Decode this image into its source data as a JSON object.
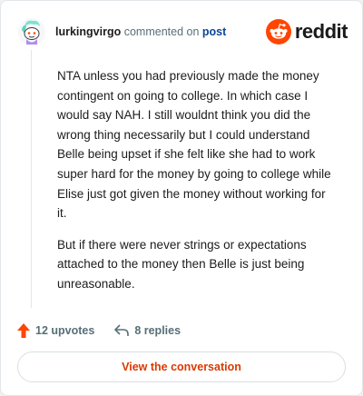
{
  "comment": {
    "author": "lurkingvirgo",
    "action_text": "commented on",
    "post_link": "post",
    "paragraphs": [
      "NTA unless you had previously made the money contingent on going to college. In which case I would say NAH. I still wouldnt think you did the wrong thing necessarily but I could understand Belle being upset if she felt like she had to work super hard for the money by going to college while Elise just got given the money without working for it.",
      "But if there were never strings or expectations attached to the money then Belle is just being unreasonable."
    ]
  },
  "brand": {
    "wordmark": "reddit",
    "color": "#ff4500"
  },
  "actions": {
    "upvotes_label": "12 upvotes",
    "replies_label": "8 replies",
    "upvote_color": "#ff4500"
  },
  "cta": {
    "label": "View the conversation",
    "color": "#d93a00"
  },
  "icons": {
    "avatar": "snoo-avatar-icon",
    "brand": "reddit-logo-icon",
    "upvote": "upvote-arrow-icon",
    "reply": "reply-arrow-icon"
  }
}
